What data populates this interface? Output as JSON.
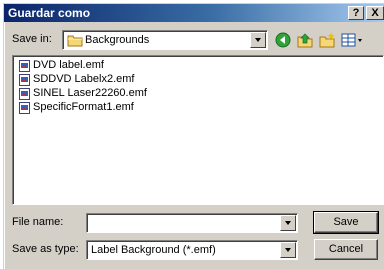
{
  "window": {
    "title": "Guardar como",
    "help_label": "?",
    "close_label": "X"
  },
  "toolbar": {
    "save_in_label": "Save in:",
    "save_in_value": "Backgrounds",
    "icons": [
      "back-icon",
      "up-folder-icon",
      "new-folder-icon",
      "views-menu-icon"
    ]
  },
  "files": [
    "DVD label.emf",
    "SDDVD Labelx2.emf",
    "SINEL Laser22260.emf",
    "SpecificFormat1.emf"
  ],
  "form": {
    "file_name_label": "File name:",
    "file_name_value": "",
    "save_as_type_label": "Save as type:",
    "save_as_type_value": "Label Background (*.emf)",
    "save_button": "Save",
    "cancel_button": "Cancel"
  },
  "colors": {
    "title_start": "#0a246a",
    "title_end": "#a6caf0",
    "face": "#d4d0c8"
  }
}
